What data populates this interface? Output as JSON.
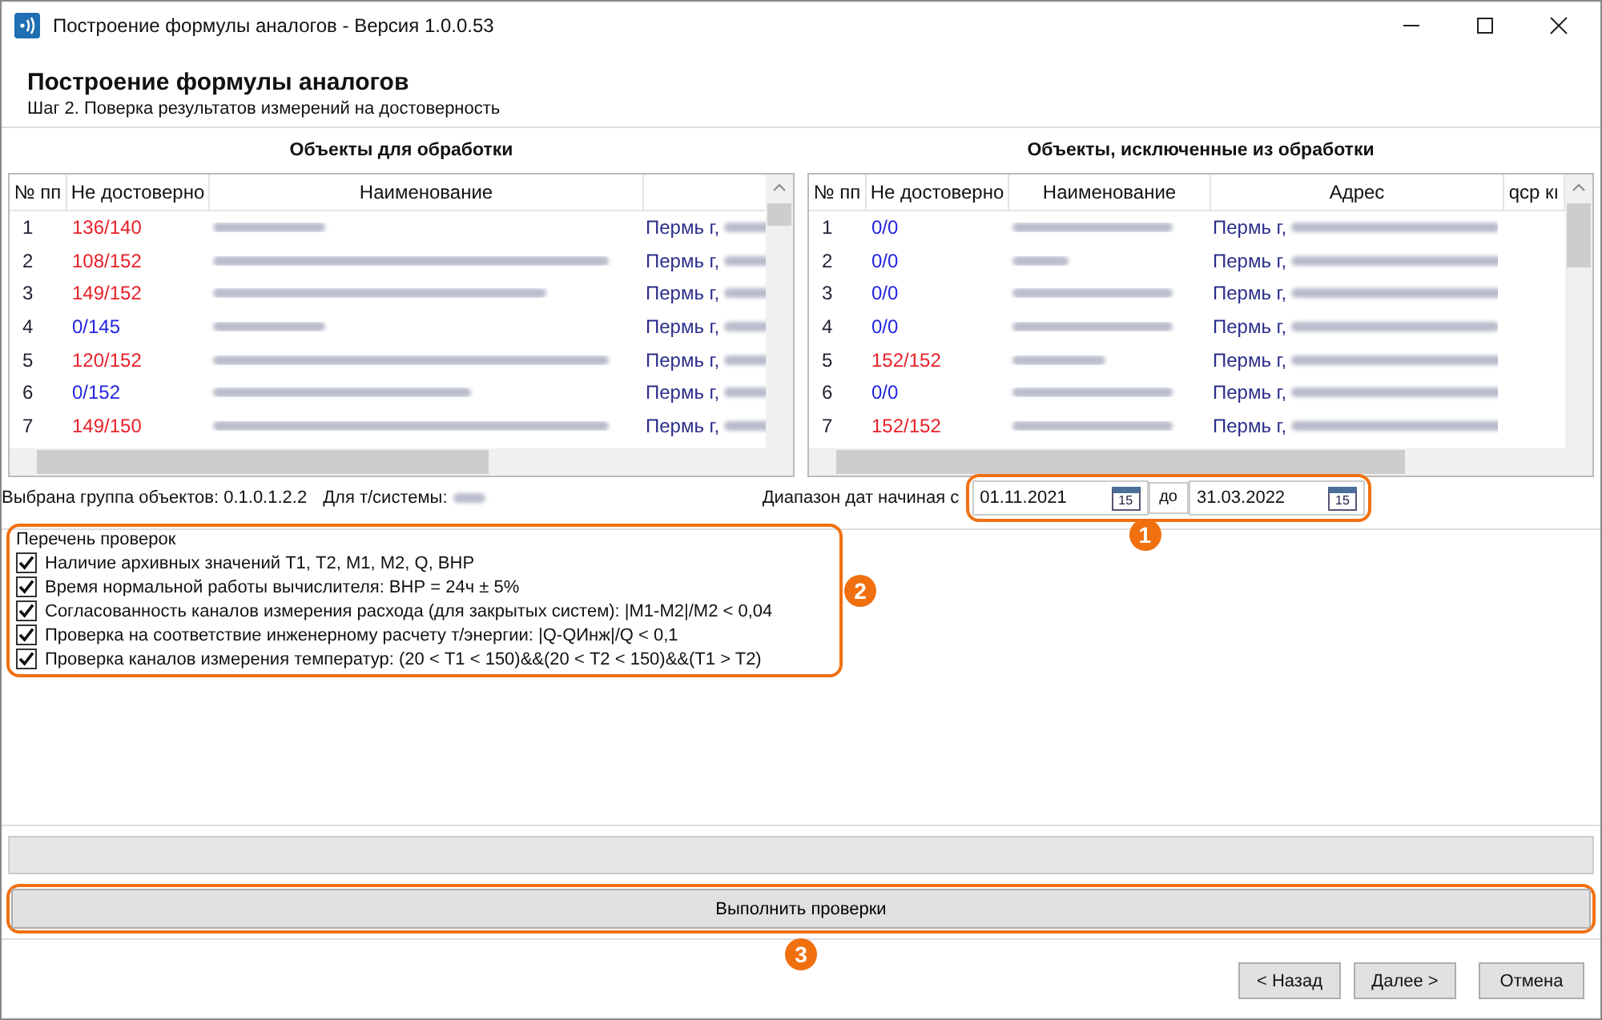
{
  "window": {
    "title": "Построение формулы аналогов - Версия 1.0.0.53"
  },
  "header": {
    "title": "Построение формулы аналогов",
    "subtitle": "Шаг 2. Поверка результатов измерений на достоверность"
  },
  "left_panel": {
    "title": "Объекты для обработки",
    "columns": [
      "№ пп",
      "Не достоверно",
      "Наименование"
    ],
    "rows": [
      {
        "number": "1",
        "invalid": "136/140",
        "alert": true,
        "address": "Пермь г,"
      },
      {
        "number": "2",
        "invalid": "108/152",
        "alert": true,
        "address": "Пермь г,"
      },
      {
        "number": "3",
        "invalid": "149/152",
        "alert": true,
        "address": "Пермь г,"
      },
      {
        "number": "4",
        "invalid": "0/145",
        "alert": false,
        "address": "Пермь г,"
      },
      {
        "number": "5",
        "invalid": "120/152",
        "alert": true,
        "address": "Пермь г,"
      },
      {
        "number": "6",
        "invalid": "0/152",
        "alert": false,
        "address": "Пермь г,"
      },
      {
        "number": "7",
        "invalid": "149/150",
        "alert": true,
        "address": "Пермь г,"
      }
    ]
  },
  "right_panel": {
    "title": "Объекты, исключенные из обработки",
    "columns": [
      "№ пп",
      "Не достоверно",
      "Наименование",
      "Адрес",
      "qср кı"
    ],
    "rows": [
      {
        "number": "1",
        "invalid": "0/0",
        "alert": false,
        "address": "Пермь г,"
      },
      {
        "number": "2",
        "invalid": "0/0",
        "alert": false,
        "address": "Пермь г,"
      },
      {
        "number": "3",
        "invalid": "0/0",
        "alert": false,
        "address": "Пермь г,"
      },
      {
        "number": "4",
        "invalid": "0/0",
        "alert": false,
        "address": "Пермь г,"
      },
      {
        "number": "5",
        "invalid": "152/152",
        "alert": true,
        "address": "Пермь г,"
      },
      {
        "number": "6",
        "invalid": "0/0",
        "alert": false,
        "address": "Пермь г,"
      },
      {
        "number": "7",
        "invalid": "152/152",
        "alert": true,
        "address": "Пермь г,"
      }
    ]
  },
  "status": {
    "group": "Выбрана группа объектов: 0.1.0.1.2.2",
    "system_label": "Для т/системы:"
  },
  "date_range": {
    "label": "Диапазон дат начиная с",
    "from": "01.11.2021",
    "separator": "до",
    "to": "31.03.2022",
    "from_calendar_day": "15",
    "to_calendar_day": "15"
  },
  "checks": {
    "title": "Перечень проверок",
    "items": [
      {
        "label": "Наличие архивных значений Т1, Т2, М1, М2, Q, ВНР",
        "checked": true
      },
      {
        "label": "Время нормальной работы вычислителя: ВНР = 24ч ± 5%",
        "checked": true
      },
      {
        "label": "Согласованность каналов измерения расхода (для закрытых систем): |M1-M2|/M2 < 0,04",
        "checked": true
      },
      {
        "label": "Проверка на соответствие инженерному расчету т/энергии: |Q-QИнж|/Q < 0,1",
        "checked": true
      },
      {
        "label": "Проверка каналов измерения температур: (20 < T1 < 150)&&(20 < T2 < 150)&&(T1 > T2)",
        "checked": true
      }
    ]
  },
  "progress": {
    "level": 0
  },
  "run_button": "Выполнить проверки",
  "nav_buttons": [
    {
      "label": "< Назад",
      "disabled": false
    },
    {
      "label": "Далее >",
      "disabled": false
    },
    {
      "label": "Отмена",
      "disabled": false
    }
  ],
  "callouts": [
    "1",
    "2",
    "3"
  ]
}
